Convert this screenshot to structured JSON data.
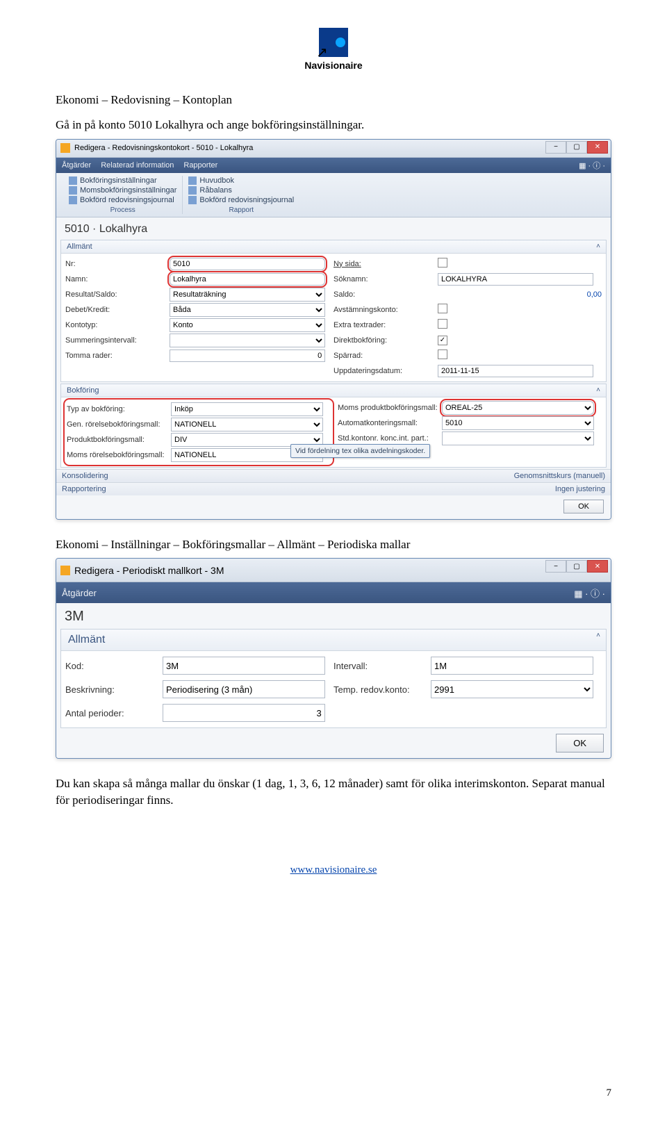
{
  "logo": {
    "name": "Navisionaire"
  },
  "intro": {
    "breadcrumb": "Ekonomi – Redovisning – Kontoplan",
    "line2": "Gå in på konto 5010 Lokalhyra och ange bokföringsinställningar."
  },
  "win1": {
    "title": "Redigera - Redovisningskontokort - 5010 - Lokalhyra",
    "ribbon_tabs": [
      "Åtgärder",
      "Relaterad information",
      "Rapporter"
    ],
    "ribbon_groups": {
      "process": {
        "label": "Process",
        "items": [
          "Bokföringsinställningar",
          "Momsbokföringsinställningar",
          "Bokförd redovisningsjournal"
        ]
      },
      "rapport": {
        "label": "Rapport",
        "items": [
          "Huvudbok",
          "Råbalans",
          "Bokförd redovisningsjournal"
        ]
      }
    },
    "page_title": "5010 · Lokalhyra",
    "sections": {
      "allmant": {
        "title": "Allmänt",
        "left": {
          "nr": {
            "label": "Nr:",
            "value": "5010"
          },
          "namn": {
            "label": "Namn:",
            "value": "Lokalhyra"
          },
          "resultat": {
            "label": "Resultat/Saldo:",
            "value": "Resultaträkning"
          },
          "debet": {
            "label": "Debet/Kredit:",
            "value": "Båda"
          },
          "kontotyp": {
            "label": "Kontotyp:",
            "value": "Konto"
          },
          "summ": {
            "label": "Summeringsintervall:",
            "value": ""
          },
          "tomma": {
            "label": "Tomma rader:",
            "value": "0"
          }
        },
        "right": {
          "nysida": {
            "label": "Ny sida:",
            "checked": false
          },
          "soknamn": {
            "label": "Söknamn:",
            "value": "LOKALHYRA"
          },
          "saldo": {
            "label": "Saldo:",
            "value": "0,00"
          },
          "avstam": {
            "label": "Avstämningskonto:",
            "checked": false
          },
          "extra": {
            "label": "Extra textrader:",
            "checked": false
          },
          "direkt": {
            "label": "Direktbokföring:",
            "checked": true
          },
          "sparrad": {
            "label": "Spärrad:",
            "checked": false
          },
          "uppdat": {
            "label": "Uppdateringsdatum:",
            "value": "2011-11-15"
          }
        }
      },
      "bokforing": {
        "title": "Bokföring",
        "left": {
          "typ": {
            "label": "Typ av bokföring:",
            "value": "Inköp"
          },
          "gen": {
            "label": "Gen. rörelsebokföringsmall:",
            "value": "NATIONELL"
          },
          "prod": {
            "label": "Produktbokföringsmall:",
            "value": "DIV"
          },
          "momsror": {
            "label": "Moms rörelsebokföringsmall:",
            "value": "NATIONELL"
          }
        },
        "right": {
          "momsprod": {
            "label": "Moms produktbokföringsmall:",
            "value": "OREAL-25"
          },
          "autokon": {
            "label": "Automatkonteringsmall:",
            "value": "5010"
          },
          "stdkon": {
            "label": "Std.kontonr. konc.int. part.:",
            "value": ""
          }
        },
        "callout": "Vid fördelning tex olika avdelningskoder."
      },
      "konsolidering": {
        "title": "Konsolidering",
        "right": "Genomsnittskurs (manuell)"
      },
      "rapportering": {
        "title": "Rapportering",
        "right": "Ingen justering"
      }
    },
    "ok": "OK"
  },
  "mid_text": "Ekonomi – Inställningar – Bokföringsmallar – Allmänt – Periodiska mallar",
  "win2": {
    "title": "Redigera - Periodiskt mallkort - 3M",
    "ribbon_tab": "Åtgärder",
    "page_title": "3M",
    "section_title": "Allmänt",
    "left": {
      "kod": {
        "label": "Kod:",
        "value": "3M"
      },
      "beskr": {
        "label": "Beskrivning:",
        "value": "Periodisering (3 mån)"
      },
      "antal": {
        "label": "Antal perioder:",
        "value": "3"
      }
    },
    "right": {
      "intervall": {
        "label": "Intervall:",
        "value": "1M"
      },
      "temp": {
        "label": "Temp. redov.konto:",
        "value": "2991"
      }
    },
    "ok": "OK"
  },
  "outro": "Du kan skapa så många mallar du önskar (1 dag, 1, 3, 6, 12 månader) samt för olika interimskonton. Separat manual för periodiseringar finns.",
  "footer_link": "www.navisionaire.se",
  "page_number": "7"
}
